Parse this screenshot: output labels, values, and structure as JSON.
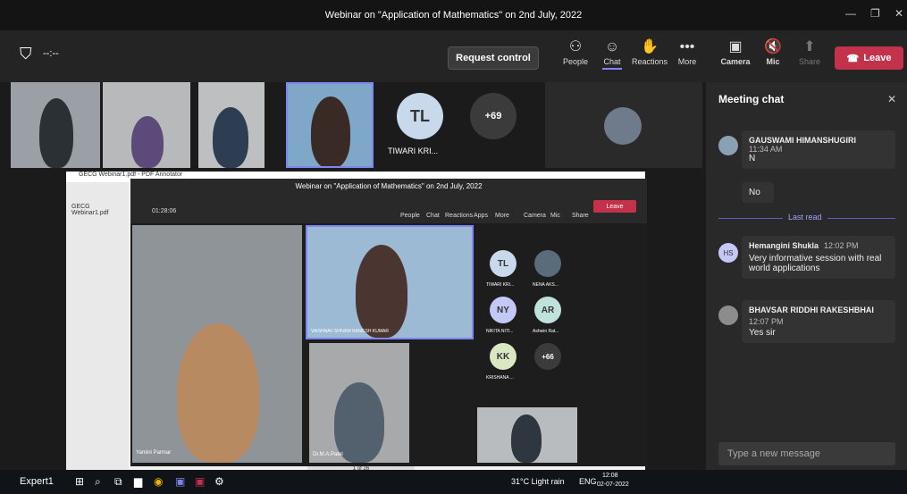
{
  "window": {
    "title": "Webinar on \"Application of Mathematics\" on 2nd July, 2022"
  },
  "toolbar": {
    "timer": "--:--",
    "request_control": "Request control",
    "people": "People",
    "chat": "Chat",
    "reactions": "Reactions",
    "more": "More",
    "camera": "Camera",
    "mic": "Mic",
    "share": "Share",
    "leave": "Leave"
  },
  "stage": {
    "tile_name": "TIWARI KRI...",
    "tile_initials": "TL",
    "overflow": "+69"
  },
  "share": {
    "title": "Webinar on \"Application of Mathematics\" on 2nd July, 2022",
    "timer": "01:28:06",
    "people": "People",
    "chat": "Chat",
    "reactions": "Reactions",
    "apps": "Apps",
    "more": "More",
    "camera": "Camera",
    "mic": "Mic",
    "share": "Share",
    "leave": "Leave",
    "main_speaker": "VAISHNAV SHIVAM RAMESH KUMAR",
    "participant1": "Yamini Parmar",
    "participant2": "Dr.M.A.Patel",
    "roster": [
      {
        "initials": "TL",
        "name": "TIWARI KRI..."
      },
      {
        "initials": "",
        "name": "NENA AKS..."
      },
      {
        "initials": "NY",
        "name": "NIKITA NITI..."
      },
      {
        "initials": "AR",
        "name": "Ashwin Rat..."
      },
      {
        "initials": "KK",
        "name": "KRISHANA ..."
      },
      {
        "initials": "+66",
        "name": ""
      }
    ],
    "pdf_app": "GECG Webinar1.pdf - PDF Annotator",
    "pdf_file": "GECG Webinar1.pdf",
    "pages": "1 of 26"
  },
  "chat": {
    "title": "Meeting chat",
    "messages": [
      {
        "author": "GAUSWAMI HIMANSHUGIRI",
        "time": "11:34 AM",
        "text": "N"
      },
      {
        "text": "No"
      },
      {
        "author": "Hemangini Shukla",
        "time": "12:02 PM",
        "text": "Very informative session with real world applications",
        "initials": "HS"
      },
      {
        "author": "BHAVSAR RIDDHI RAKESHBHAI",
        "time": "12:07 PM",
        "text": "Yes sir"
      }
    ],
    "last_read": "Last read",
    "placeholder": "Type a new message"
  },
  "taskbar": {
    "user": "Expert1",
    "weather": "31°C Light rain",
    "lang": "ENG",
    "time": "12:08",
    "date": "02-07-2022"
  }
}
